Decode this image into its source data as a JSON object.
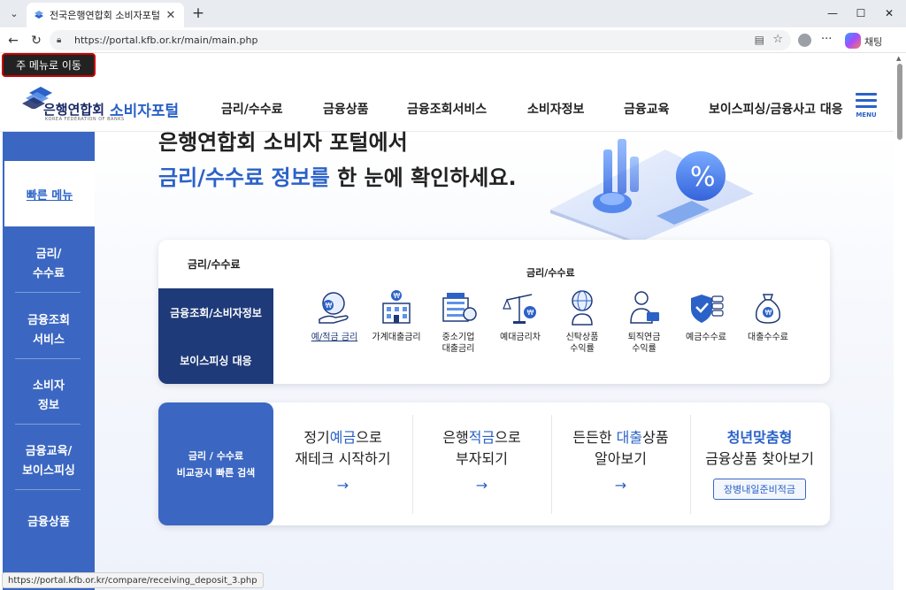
{
  "browser": {
    "tab_title": "전국은행연합회 소비자포털",
    "url": "https://portal.kfb.or.kr/main/main.php",
    "chat_label": "채팅",
    "status_url": "https://portal.kfb.or.kr/compare/receiving_deposit_3.php"
  },
  "header": {
    "skip_link": "주 메뉴로 이동",
    "logo_name": "은행연합회",
    "logo_eng": "KOREA FEDERATION OF BANKS",
    "portal_name": "소비자포털",
    "gnb": [
      "금리/수수료",
      "금융상품",
      "금융조회서비스",
      "소비자정보",
      "금융교육",
      "보이스피싱/금융사고 대응"
    ],
    "menu_label": "MENU"
  },
  "side": {
    "top": "빠른 메뉴",
    "items": [
      "금리/\n수수료",
      "금융조회\n서비스",
      "소비자\n정보",
      "금융교육/\n보이스피싱",
      "금융상품"
    ]
  },
  "hero": {
    "line1": "은행연합회 소비자 포털에서",
    "line2_highlight": "금리/수수료 정보를",
    "line2_rest": " 한 눈에 확인하세요."
  },
  "rate_panel": {
    "title": "금리/수수료",
    "tabs": [
      "금융조회/소비자정보",
      "보이스피싱 대응"
    ],
    "subtitle": "금리/수수료",
    "icons": [
      {
        "label": "예/적금 금리",
        "icon": "coin-hand-icon"
      },
      {
        "label": "가계대출금리",
        "icon": "bank-building-icon"
      },
      {
        "label": "중소기업\n대출금리",
        "icon": "company-icon"
      },
      {
        "label": "예대금리차",
        "icon": "scale-icon"
      },
      {
        "label": "신탁상품\n수익률",
        "icon": "globe-person-icon"
      },
      {
        "label": "퇴직연금\n수익률",
        "icon": "retiree-icon"
      },
      {
        "label": "예금수수료",
        "icon": "shield-coin-icon"
      },
      {
        "label": "대출수수료",
        "icon": "money-bag-icon"
      }
    ]
  },
  "products_panel": {
    "left_title": "금리 / 수수료\n비교공시 빠른 검색",
    "cards": [
      {
        "pre": "정기",
        "hl": "예금",
        "post": "으로",
        "line2": "재테크 시작하기"
      },
      {
        "pre": "은행",
        "hl": "적금",
        "post": "으로",
        "line2": "부자되기"
      },
      {
        "pre": "든든한 ",
        "hl": "대출",
        "post": "상품",
        "line2": "알아보기"
      },
      {
        "pre": "",
        "hl": "청년맞춤형",
        "post": "",
        "line2": "금융상품 찾아보기",
        "badge": "장병내일준비적금"
      }
    ],
    "arrow": "→"
  }
}
